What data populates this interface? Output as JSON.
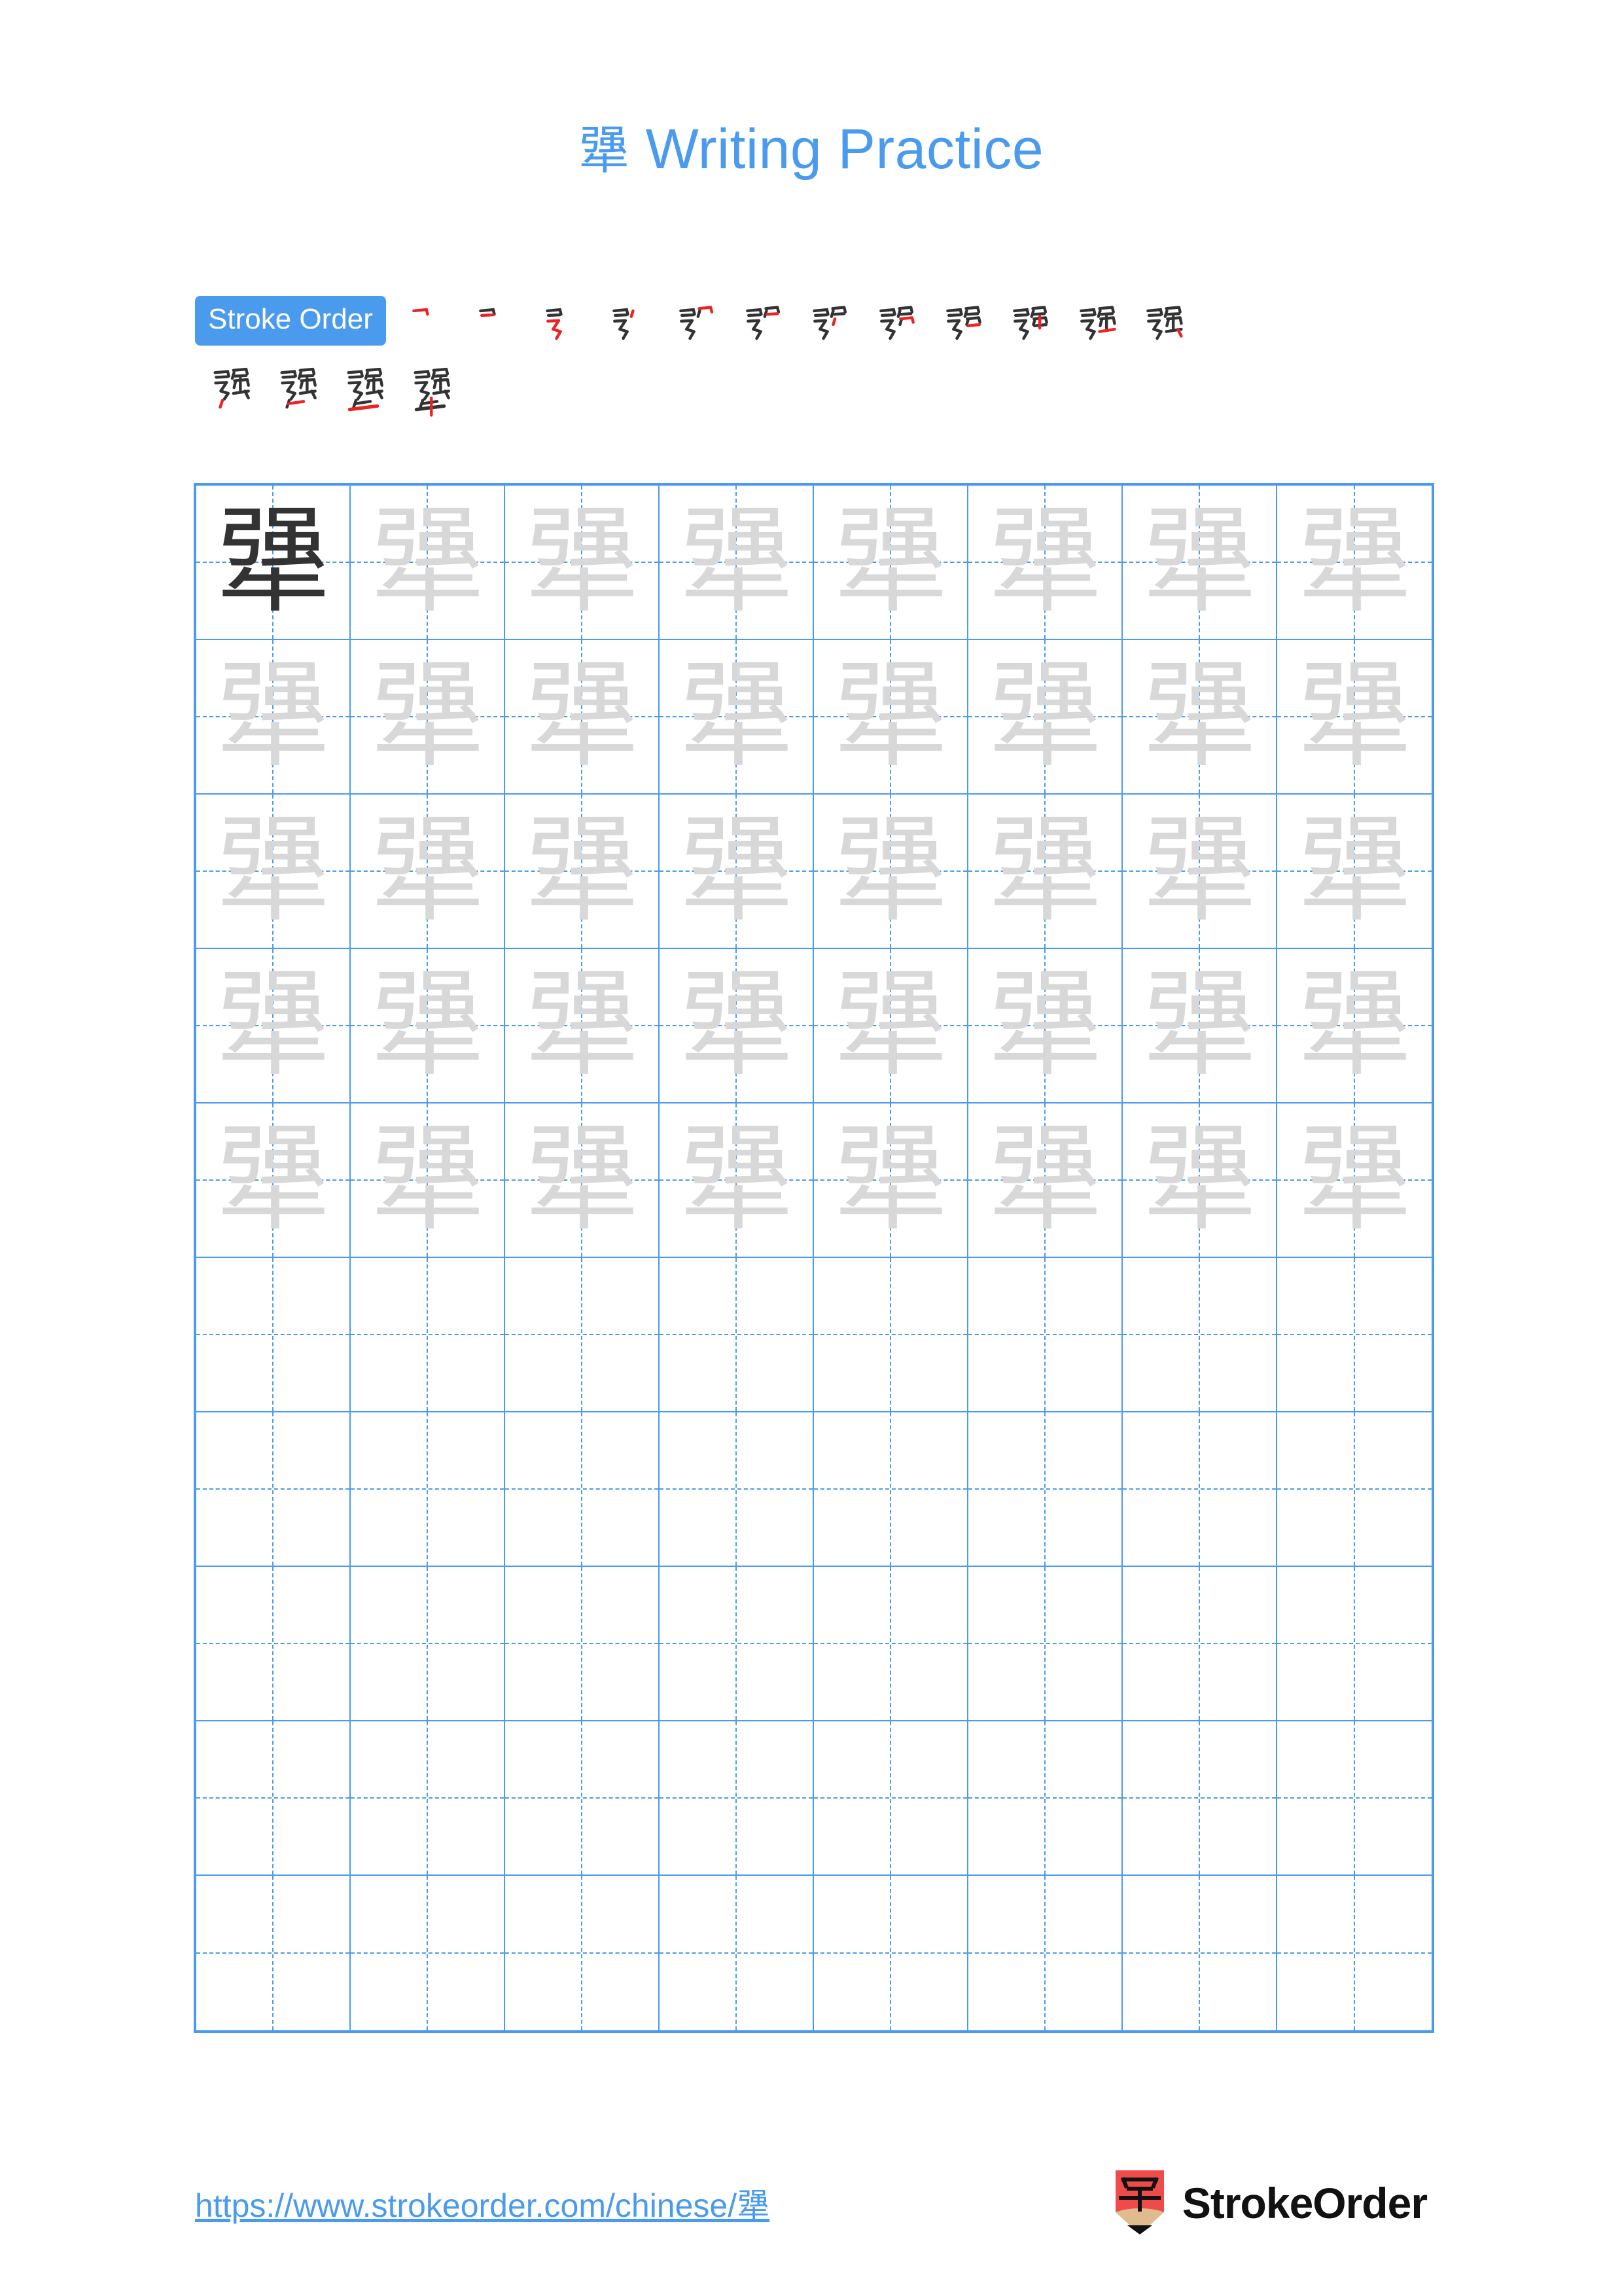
{
  "document": {
    "character": "犟",
    "title_suffix": "Writing Practice",
    "page_background": "#ffffff"
  },
  "colors": {
    "accent_blue": "#4a9aee",
    "grid_line": "#4a9aee",
    "example_char": "#333333",
    "trace_char": "#d8d8d8",
    "new_stroke_red": "#ee2222",
    "drawn_stroke_dark": "#333333",
    "logo_red": "#ef4b4b",
    "logo_tan": "#e0bb8e"
  },
  "stroke_order": {
    "badge_label": "Stroke Order",
    "total_strokes": 16,
    "row_1_count": 12,
    "row_2_count": 4,
    "steps": [
      {
        "index": 1,
        "partial": "乛"
      },
      {
        "index": 2,
        "partial": "フ"
      },
      {
        "index": 3,
        "partial": "弓"
      },
      {
        "index": 4,
        "partial": "弓丶"
      },
      {
        "index": 5,
        "partial": "弜"
      },
      {
        "index": 6,
        "partial": "弜"
      },
      {
        "index": 7,
        "partial": "弣"
      },
      {
        "index": 8,
        "partial": "弨"
      },
      {
        "index": 9,
        "partial": "弱"
      },
      {
        "index": 10,
        "partial": "弶"
      },
      {
        "index": 11,
        "partial": "强"
      },
      {
        "index": 12,
        "partial": "强"
      },
      {
        "index": 13,
        "partial": "强"
      },
      {
        "index": 14,
        "partial": "强"
      },
      {
        "index": 15,
        "partial": "强虫"
      },
      {
        "index": 16,
        "partial": "犟"
      }
    ]
  },
  "practice_grid": {
    "columns": 8,
    "rows": 10,
    "filled_rows": 5,
    "blank_rows": 5,
    "example_cell_index": 0,
    "cells": [
      {
        "mode": "example"
      },
      {
        "mode": "trace"
      },
      {
        "mode": "trace"
      },
      {
        "mode": "trace"
      },
      {
        "mode": "trace"
      },
      {
        "mode": "trace"
      },
      {
        "mode": "trace"
      },
      {
        "mode": "trace"
      },
      {
        "mode": "trace"
      },
      {
        "mode": "trace"
      },
      {
        "mode": "trace"
      },
      {
        "mode": "trace"
      },
      {
        "mode": "trace"
      },
      {
        "mode": "trace"
      },
      {
        "mode": "trace"
      },
      {
        "mode": "trace"
      },
      {
        "mode": "trace"
      },
      {
        "mode": "trace"
      },
      {
        "mode": "trace"
      },
      {
        "mode": "trace"
      },
      {
        "mode": "trace"
      },
      {
        "mode": "trace"
      },
      {
        "mode": "trace"
      },
      {
        "mode": "trace"
      },
      {
        "mode": "trace"
      },
      {
        "mode": "trace"
      },
      {
        "mode": "trace"
      },
      {
        "mode": "trace"
      },
      {
        "mode": "trace"
      },
      {
        "mode": "trace"
      },
      {
        "mode": "trace"
      },
      {
        "mode": "trace"
      },
      {
        "mode": "trace"
      },
      {
        "mode": "trace"
      },
      {
        "mode": "trace"
      },
      {
        "mode": "trace"
      },
      {
        "mode": "trace"
      },
      {
        "mode": "trace"
      },
      {
        "mode": "trace"
      },
      {
        "mode": "trace"
      },
      {
        "mode": "blank"
      },
      {
        "mode": "blank"
      },
      {
        "mode": "blank"
      },
      {
        "mode": "blank"
      },
      {
        "mode": "blank"
      },
      {
        "mode": "blank"
      },
      {
        "mode": "blank"
      },
      {
        "mode": "blank"
      },
      {
        "mode": "blank"
      },
      {
        "mode": "blank"
      },
      {
        "mode": "blank"
      },
      {
        "mode": "blank"
      },
      {
        "mode": "blank"
      },
      {
        "mode": "blank"
      },
      {
        "mode": "blank"
      },
      {
        "mode": "blank"
      },
      {
        "mode": "blank"
      },
      {
        "mode": "blank"
      },
      {
        "mode": "blank"
      },
      {
        "mode": "blank"
      },
      {
        "mode": "blank"
      },
      {
        "mode": "blank"
      },
      {
        "mode": "blank"
      },
      {
        "mode": "blank"
      },
      {
        "mode": "blank"
      },
      {
        "mode": "blank"
      },
      {
        "mode": "blank"
      },
      {
        "mode": "blank"
      },
      {
        "mode": "blank"
      },
      {
        "mode": "blank"
      },
      {
        "mode": "blank"
      },
      {
        "mode": "blank"
      },
      {
        "mode": "blank"
      },
      {
        "mode": "blank"
      },
      {
        "mode": "blank"
      },
      {
        "mode": "blank"
      },
      {
        "mode": "blank"
      },
      {
        "mode": "blank"
      },
      {
        "mode": "blank"
      },
      {
        "mode": "blank"
      }
    ]
  },
  "footer": {
    "url_prefix": "https://www.strokeorder.com/chinese/",
    "url_character": "犟",
    "brand_name": "StrokeOrder",
    "logo_glyph": "字"
  }
}
